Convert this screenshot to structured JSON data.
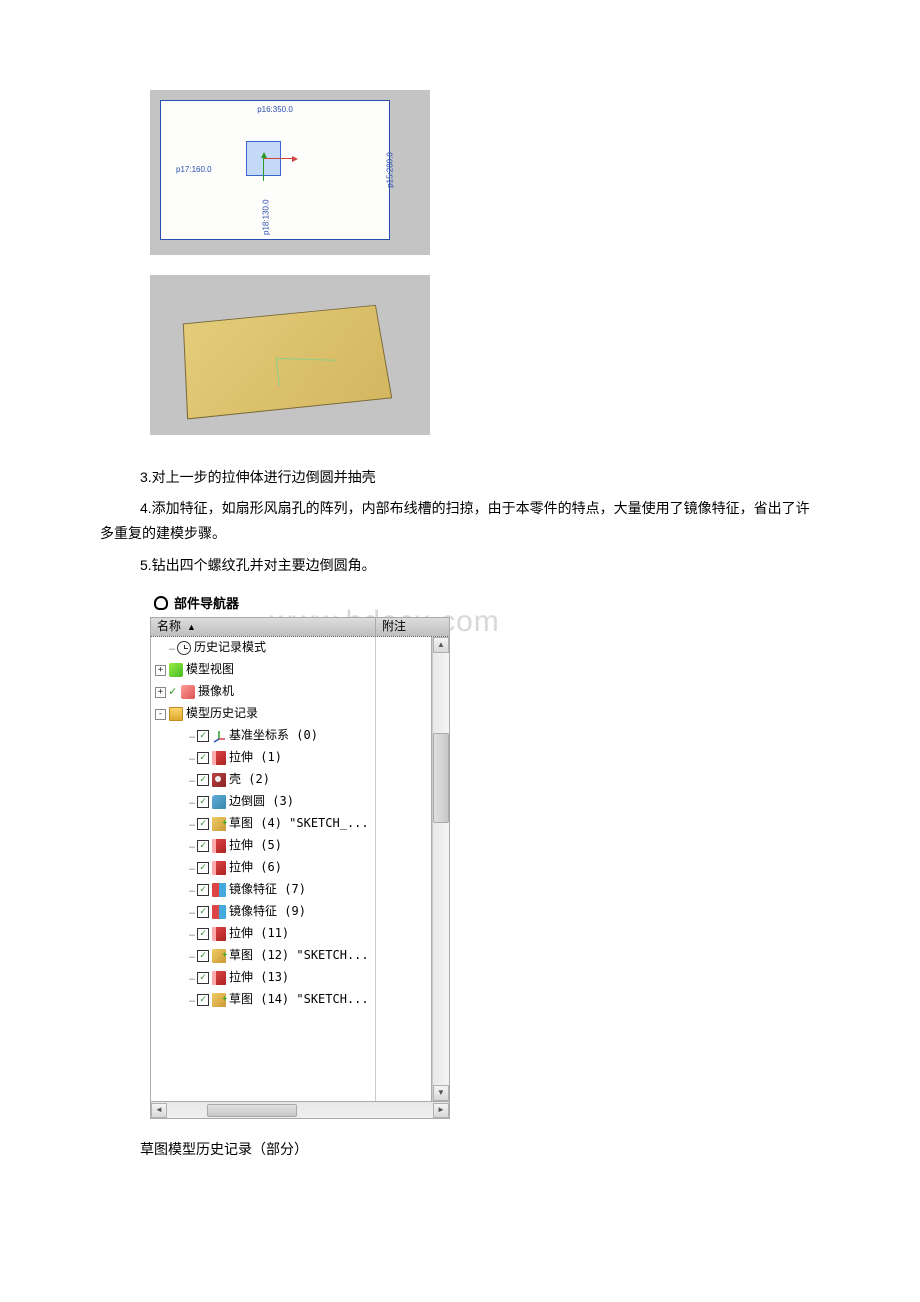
{
  "sketch1": {
    "dim_top": "p16:350.0",
    "dim_left": "p17:160.0",
    "dim_bottom": "p18:130.0",
    "dim_right": "p15:280.0"
  },
  "text": {
    "para3": "3.对上一步的拉伸体进行边倒圆并抽壳",
    "para4": "4.添加特征，如扇形风扇孔的阵列，内部布线槽的扫掠，由于本零件的特点，大量使用了镜像特征，省出了许多重复的建模步骤。",
    "para5": "5.钻出四个螺纹孔并对主要边倒圆角。",
    "caption": "草图模型历史记录（部分）"
  },
  "watermark": "www.bdocx.com",
  "panel": {
    "title": "部件导航器",
    "col_name": "名称",
    "col_note": "附注"
  },
  "tree": [
    {
      "level": 1,
      "expander": "",
      "check": false,
      "iconClass": "icon-clock",
      "label": "历史记录模式"
    },
    {
      "level": 0,
      "expander": "+",
      "check": false,
      "iconClass": "icon-model",
      "label": "模型视图"
    },
    {
      "level": 0,
      "expander": "+",
      "check": false,
      "preIcon": "check",
      "iconClass": "icon-camera",
      "label": "摄像机"
    },
    {
      "level": 0,
      "expander": "-",
      "check": false,
      "iconClass": "icon-folder",
      "label": "模型历史记录"
    },
    {
      "level": 2,
      "expander": "",
      "check": true,
      "iconClass": "icon-csys",
      "label": "基准坐标系 (0)"
    },
    {
      "level": 2,
      "expander": "",
      "check": true,
      "iconClass": "icon-extrude",
      "label": "拉伸 (1)"
    },
    {
      "level": 2,
      "expander": "",
      "check": true,
      "iconClass": "icon-shell",
      "label": "壳 (2)"
    },
    {
      "level": 2,
      "expander": "",
      "check": true,
      "iconClass": "icon-fillet",
      "label": "边倒圆 (3)"
    },
    {
      "level": 2,
      "expander": "",
      "check": true,
      "iconClass": "icon-sketch",
      "label": "草图 (4) \"SKETCH_..."
    },
    {
      "level": 2,
      "expander": "",
      "check": true,
      "iconClass": "icon-extrude",
      "label": "拉伸 (5)"
    },
    {
      "level": 2,
      "expander": "",
      "check": true,
      "iconClass": "icon-extrude",
      "label": "拉伸 (6)"
    },
    {
      "level": 2,
      "expander": "",
      "check": true,
      "iconClass": "icon-mirror",
      "label": "镜像特征 (7)"
    },
    {
      "level": 2,
      "expander": "",
      "check": true,
      "iconClass": "icon-mirror",
      "label": "镜像特征 (9)"
    },
    {
      "level": 2,
      "expander": "",
      "check": true,
      "iconClass": "icon-extrude",
      "label": "拉伸 (11)"
    },
    {
      "level": 2,
      "expander": "",
      "check": true,
      "iconClass": "icon-sketch",
      "label": "草图 (12) \"SKETCH..."
    },
    {
      "level": 2,
      "expander": "",
      "check": true,
      "iconClass": "icon-extrude",
      "label": "拉伸 (13)"
    },
    {
      "level": 2,
      "expander": "",
      "check": true,
      "iconClass": "icon-sketch",
      "label": "草图 (14) \"SKETCH..."
    }
  ]
}
